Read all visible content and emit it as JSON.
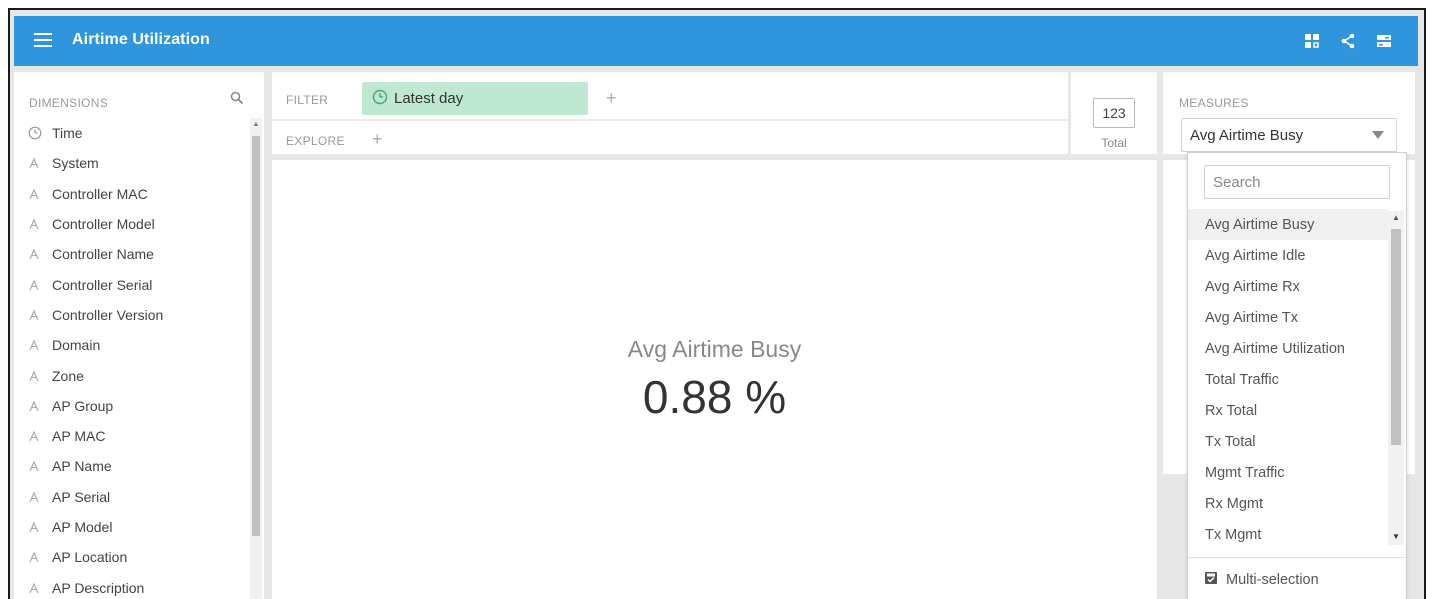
{
  "header": {
    "title": "Airtime Utilization",
    "icons": [
      "menu-icon",
      "dashboard-grid-icon",
      "share-icon",
      "toggle-panels-icon"
    ]
  },
  "dimensions": {
    "title": "DIMENSIONS",
    "items": [
      {
        "label": "Time",
        "icon": "clock-icon"
      },
      {
        "label": "System",
        "icon": "string-dimension-icon"
      },
      {
        "label": "Controller MAC",
        "icon": "string-dimension-icon"
      },
      {
        "label": "Controller Model",
        "icon": "string-dimension-icon"
      },
      {
        "label": "Controller Name",
        "icon": "string-dimension-icon"
      },
      {
        "label": "Controller Serial",
        "icon": "string-dimension-icon"
      },
      {
        "label": "Controller Version",
        "icon": "string-dimension-icon"
      },
      {
        "label": "Domain",
        "icon": "string-dimension-icon"
      },
      {
        "label": "Zone",
        "icon": "string-dimension-icon"
      },
      {
        "label": "AP Group",
        "icon": "string-dimension-icon"
      },
      {
        "label": "AP MAC",
        "icon": "string-dimension-icon"
      },
      {
        "label": "AP Name",
        "icon": "string-dimension-icon"
      },
      {
        "label": "AP Serial",
        "icon": "string-dimension-icon"
      },
      {
        "label": "AP Model",
        "icon": "string-dimension-icon"
      },
      {
        "label": "AP Location",
        "icon": "string-dimension-icon"
      },
      {
        "label": "AP Description",
        "icon": "string-dimension-icon"
      }
    ]
  },
  "filter": {
    "label": "FILTER",
    "pill": "Latest day",
    "explore_label": "EXPLORE"
  },
  "total": {
    "value": "123",
    "label": "Total"
  },
  "visualization": {
    "measure_label": "Avg Airtime Busy",
    "value": "0.88 %"
  },
  "measures": {
    "title": "MEASURES",
    "selected": "Avg Airtime Busy",
    "search_placeholder": "Search",
    "options": [
      "Avg Airtime Busy",
      "Avg Airtime Idle",
      "Avg Airtime Rx",
      "Avg Airtime Tx",
      "Avg Airtime Utilization",
      "Total Traffic",
      "Rx Total",
      "Tx Total",
      "Mgmt Traffic",
      "Rx Mgmt",
      "Tx Mgmt"
    ],
    "multi_selection": "Multi-selection"
  },
  "colors": {
    "header_bg": "#2f95dc",
    "filter_pill_bg": "#bfe8d3"
  }
}
